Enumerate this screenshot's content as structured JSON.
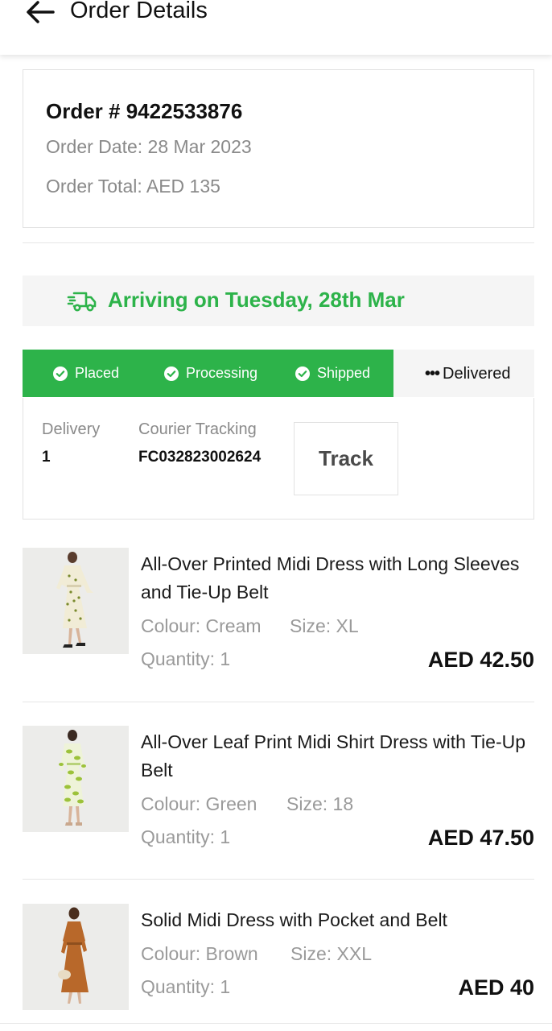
{
  "header": {
    "title": "Order Details",
    "back_icon": "arrow-left-icon"
  },
  "order": {
    "number": "Order # 9422533876",
    "date": "Order Date: 28 Mar 2023",
    "total": "Order Total: AED 135"
  },
  "arrival": {
    "icon": "delivery-truck-icon",
    "text": "Arriving on Tuesday, 28th Mar",
    "color": "#2db34a"
  },
  "progress": {
    "completed_color": "#2db34a",
    "steps": [
      {
        "label": "Placed",
        "done": true
      },
      {
        "label": "Processing",
        "done": true
      },
      {
        "label": "Shipped",
        "done": true
      },
      {
        "label": "Delivered",
        "done": false
      }
    ],
    "pending_prefix": "•••"
  },
  "tracking": {
    "delivery_label": "Delivery",
    "delivery_value": "1",
    "courier_label": "Courier Tracking",
    "courier_value": "FC032823002624",
    "track_button": "Track"
  },
  "products": [
    {
      "title": "All-Over Printed Midi Dress with Long Sleeves and Tie-Up Belt",
      "colour": "Colour: Cream",
      "size": "Size: XL",
      "quantity": "Quantity: 1",
      "price": "AED 42.50",
      "image": "product-image-cream-dress"
    },
    {
      "title": "All-Over Leaf Print Midi Shirt Dress with Tie-Up Belt",
      "colour": "Colour: Green",
      "size": "Size: 18",
      "quantity": "Quantity: 1",
      "price": "AED 47.50",
      "image": "product-image-green-dress"
    },
    {
      "title": "Solid Midi Dress with Pocket and Belt",
      "colour": "Colour: Brown",
      "size": "Size: XXL",
      "quantity": "Quantity: 1",
      "price": "AED 40",
      "image": "product-image-brown-dress"
    }
  ]
}
